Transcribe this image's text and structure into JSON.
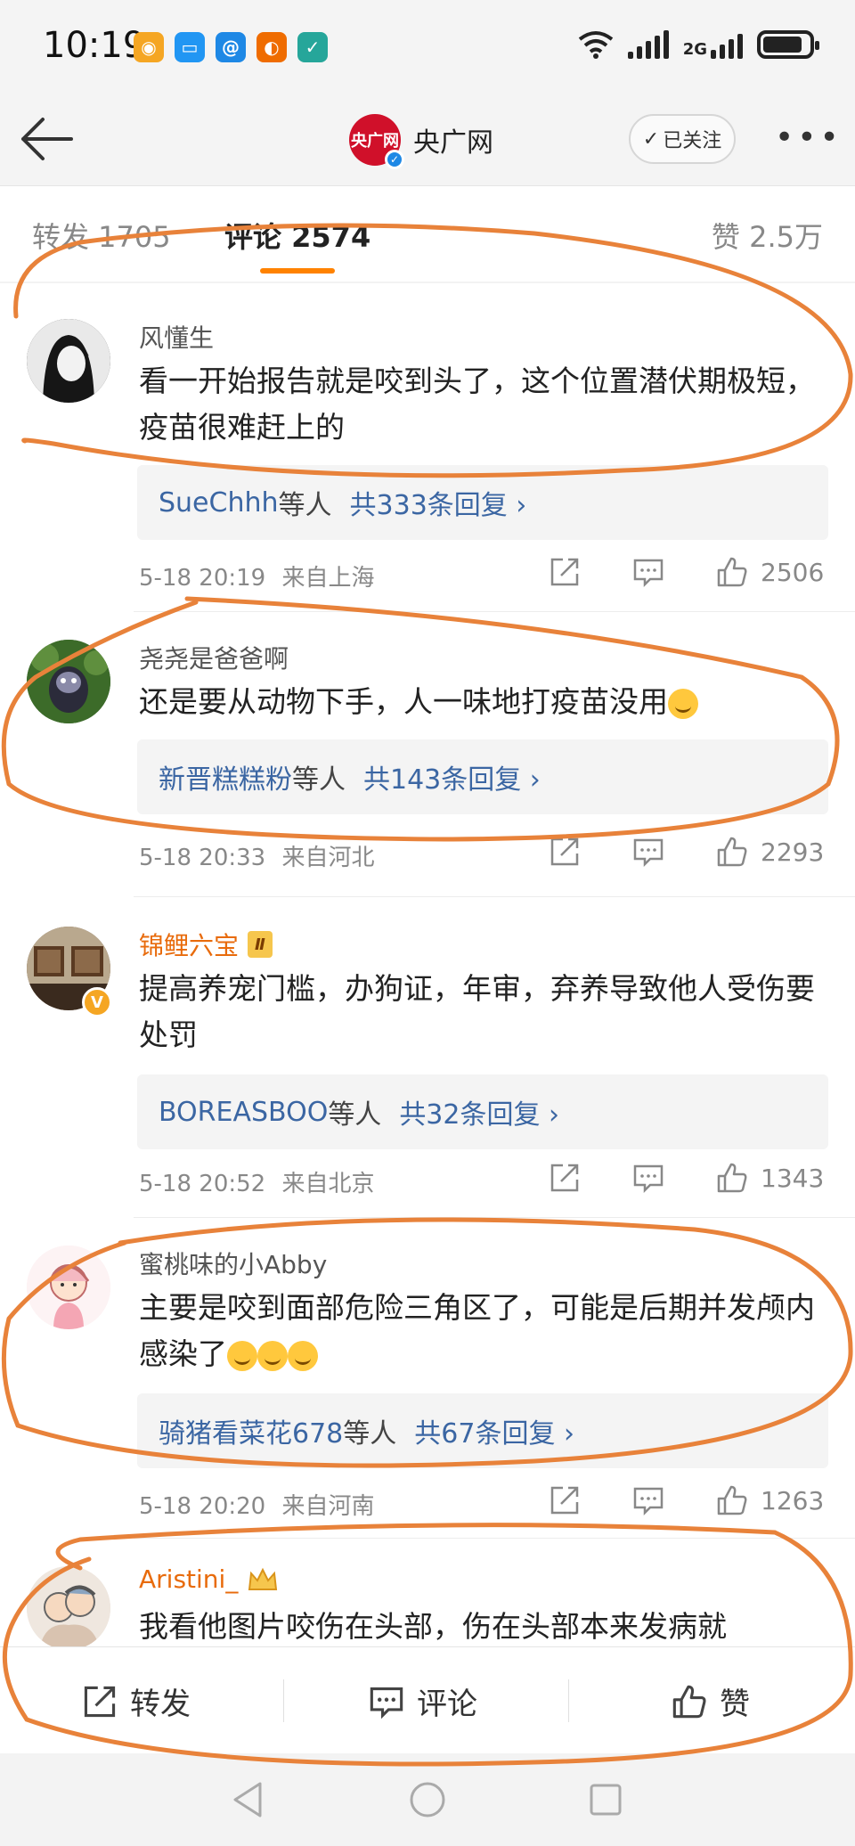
{
  "status_bar": {
    "time": "10:19",
    "net_label": "2G",
    "app_icons": [
      "weibo-icon",
      "message-icon",
      "browser-icon",
      "weibo-alt-icon",
      "shield-icon"
    ]
  },
  "header": {
    "account_logo_text": "央广网",
    "account_name": "央广网",
    "follow_label": "已关注"
  },
  "tabs": {
    "repost": "转发 1705",
    "comments": "评论 2574",
    "likes": "赞 2.5万"
  },
  "comments": [
    {
      "username": "风懂生",
      "text": "看一开始报告就是咬到头了，这个位置潜伏期极短，疫苗很难赶上的",
      "reply_user": "SueChhh",
      "reply_mid": "等人",
      "reply_count": "共333条回复 ›",
      "time": "5-18 20:19",
      "location": "来自上海",
      "likes": "2506"
    },
    {
      "username": "尧尧是爸爸啊",
      "text": "还是要从动物下手，人一味地打疫苗没用",
      "reply_user": "新晋糕糕粉",
      "reply_mid": "等人",
      "reply_count": "共143条回复 ›",
      "time": "5-18 20:33",
      "location": "来自河北",
      "likes": "2293"
    },
    {
      "username": "锦鲤六宝",
      "badge": "Ⅱ",
      "text": "提高养宠门槛，办狗证，年审，弃养导致他人受伤要处罚",
      "reply_user": "BOREASBOO",
      "reply_mid": "等人",
      "reply_count": "共32条回复 ›",
      "time": "5-18 20:52",
      "location": "来自北京",
      "likes": "1343"
    },
    {
      "username": "蜜桃味的小Abby",
      "text": "主要是咬到面部危险三角区了，可能是后期并发颅内感染了",
      "reply_user": "骑猪看菜花678",
      "reply_mid": "等人",
      "reply_count": "共67条回复 ›",
      "time": "5-18 20:20",
      "location": "来自河南",
      "likes": "1263"
    },
    {
      "username": "Aristini_",
      "text": "我看他图片咬伤在头部，伤在头部本来发病就"
    }
  ],
  "bottom_bar": {
    "repost": "转发",
    "comment": "评论",
    "like": "赞"
  },
  "colors": {
    "accent": "#ff8200",
    "link": "#3b66a3",
    "markup": "#e8823a"
  }
}
